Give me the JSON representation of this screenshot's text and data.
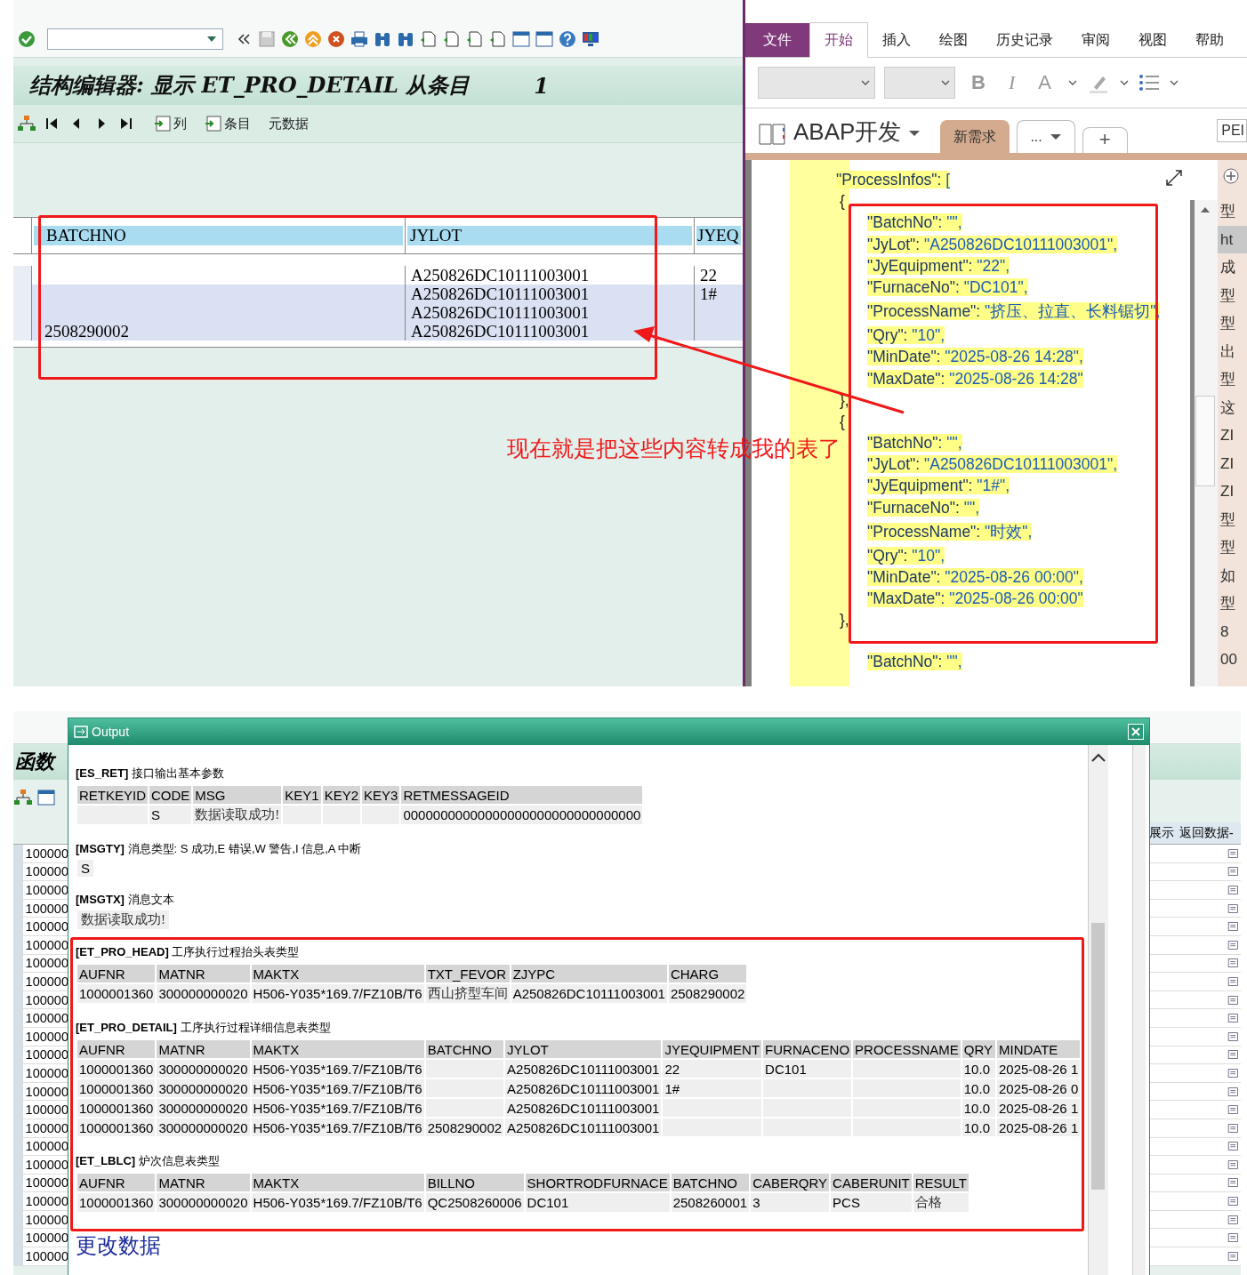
{
  "sap_editor": {
    "title": "结构编辑器: 显示 ET_PRO_DETAIL 从条目",
    "entry_number": "1",
    "toolbar_buttons": [
      {
        "kind": "icon-text",
        "label": "列"
      },
      {
        "kind": "icon-text",
        "label": "条目"
      },
      {
        "kind": "text",
        "label": "元数据"
      }
    ],
    "columns": [
      "BATCHNO",
      "JYLOT",
      "JYEQ"
    ],
    "rows": [
      {
        "cells": [
          "",
          "A250826DC10111003001",
          "22"
        ],
        "highlighted": false
      },
      {
        "cells": [
          "",
          "A250826DC10111003001",
          "1#"
        ],
        "highlighted": true
      },
      {
        "cells": [
          "",
          "A250826DC10111003001",
          ""
        ],
        "highlighted": true
      },
      {
        "cells": [
          "2508290002",
          "A250826DC10111003001",
          ""
        ],
        "highlighted": true
      }
    ]
  },
  "annotation": {
    "text": "现在就是把这些内容转成我的表了"
  },
  "onenote": {
    "ribbon_tabs": [
      {
        "label": "文件",
        "kind": "file",
        "selected": false
      },
      {
        "label": "开始",
        "kind": "tab",
        "selected": true
      },
      {
        "label": "插入",
        "kind": "tab",
        "selected": false
      },
      {
        "label": "绘图",
        "kind": "tab",
        "selected": false
      },
      {
        "label": "历史记录",
        "kind": "tab",
        "selected": false
      },
      {
        "label": "审阅",
        "kind": "tab",
        "selected": false
      },
      {
        "label": "视图",
        "kind": "tab",
        "selected": false
      },
      {
        "label": "帮助",
        "kind": "tab",
        "selected": false
      }
    ],
    "format_buttons": [
      "B",
      "I",
      "A"
    ],
    "notebook": "ABAP开发",
    "section_tabs": [
      {
        "label": "新需求",
        "selected": true
      },
      {
        "label": "...",
        "selected": false
      }
    ],
    "add_section": "+",
    "search_text": "PEI",
    "lines": [
      {
        "kind": "head",
        "key": "\"ProcessInfos\":",
        "value": "["
      },
      {
        "kind": "brace",
        "key": "{"
      },
      {
        "kind": "pair",
        "key": "\"BatchNo\":",
        "value": "\"\","
      },
      {
        "kind": "pair",
        "key": "\"JyLot\":",
        "value": "\"A250826DC10111003001\","
      },
      {
        "kind": "pair",
        "key": "\"JyEquipment\":",
        "value": "\"22\","
      },
      {
        "kind": "pair",
        "key": "\"FurnaceNo\":",
        "value": "\"DC101\","
      },
      {
        "kind": "pair",
        "key": "\"ProcessName\":",
        "value": "\"挤压、拉直、长料锯切\","
      },
      {
        "kind": "pair",
        "key": "\"Qry\":",
        "value": "\"10\","
      },
      {
        "kind": "pair",
        "key": "\"MinDate\":",
        "value": "\"2025-08-26 14:28\","
      },
      {
        "kind": "pair",
        "key": "\"MaxDate\":",
        "value": "\"2025-08-26 14:28\""
      },
      {
        "kind": "brace",
        "key": "},"
      },
      {
        "kind": "brace",
        "key": "{"
      },
      {
        "kind": "pair",
        "key": "\"BatchNo\":",
        "value": "\"\","
      },
      {
        "kind": "pair",
        "key": "\"JyLot\":",
        "value": "\"A250826DC10111003001\","
      },
      {
        "kind": "pair",
        "key": "\"JyEquipment\":",
        "value": "\"1#\","
      },
      {
        "kind": "pair",
        "key": "\"FurnaceNo\":",
        "value": "\"\","
      },
      {
        "kind": "pair",
        "key": "\"ProcessName\":",
        "value": "\"时效\","
      },
      {
        "kind": "pair",
        "key": "\"Qry\":",
        "value": "\"10\","
      },
      {
        "kind": "pair",
        "key": "\"MinDate\":",
        "value": "\"2025-08-26 00:00\","
      },
      {
        "kind": "pair",
        "key": "\"MaxDate\":",
        "value": "\"2025-08-26 00:00\""
      },
      {
        "kind": "brace",
        "key": "},"
      },
      {
        "kind": "pair",
        "key": "\"BatchNo\":",
        "value": "\"\","
      }
    ],
    "pages": [
      {
        "label": "型",
        "selected": false
      },
      {
        "label": "ht",
        "selected": true
      },
      {
        "label": "成",
        "selected": false
      },
      {
        "label": "型",
        "selected": false
      },
      {
        "label": "型",
        "selected": false
      },
      {
        "label": "出",
        "selected": false
      },
      {
        "label": "型",
        "selected": false
      },
      {
        "label": "这",
        "selected": false
      },
      {
        "label": "ZI",
        "selected": false
      },
      {
        "label": "ZI",
        "selected": false
      },
      {
        "label": "ZI",
        "selected": false
      },
      {
        "label": "型",
        "selected": false
      },
      {
        "label": "型",
        "selected": false
      },
      {
        "label": "如",
        "selected": false
      },
      {
        "label": "型",
        "selected": false
      },
      {
        "label": "8",
        "selected": false
      },
      {
        "label": "00",
        "selected": false
      }
    ]
  },
  "function_screen": {
    "title": "函数",
    "right_headers": [
      "展示",
      "返回数据-"
    ],
    "row_keys": [
      "100000",
      "100000",
      "100000",
      "100000",
      "100000",
      "100000",
      "100000",
      "100000",
      "100000",
      "100000",
      "100000",
      "100000",
      "100000",
      "100000",
      "100000",
      "100000",
      "100000",
      "100000",
      "100000",
      "100000",
      "100000",
      "100000",
      "100000"
    ]
  },
  "output": {
    "title": "Output",
    "sections": [
      {
        "kind": "table",
        "tag": "[ES_RET]",
        "description": "接口输出基本参数",
        "columns": [
          "RETKEYID",
          "CODE",
          "MSG",
          "KEY1",
          "KEY2",
          "KEY3",
          "RETMESSAGEID"
        ],
        "rows": [
          [
            "",
            "S",
            "数据读取成功!",
            "",
            "",
            "",
            "00000000000000000000000000000000"
          ]
        ]
      },
      {
        "kind": "value",
        "tag": "[MSGTY]",
        "description": "消息类型: S 成功,E 错误,W 警告,I 信息,A 中断",
        "value": "S"
      },
      {
        "kind": "value",
        "tag": "[MSGTX]",
        "description": "消息文本",
        "value": "数据读取成功!"
      },
      {
        "kind": "table",
        "tag": "[ET_PRO_HEAD]",
        "description": "工序执行过程抬头表类型",
        "columns": [
          "AUFNR",
          "MATNR",
          "MAKTX",
          "TXT_FEVOR",
          "ZJYPC",
          "CHARG"
        ],
        "rows": [
          [
            "1000001360",
            "300000000020",
            "H506-Y035*169.7/FZ10B/T6",
            "西山挤型车间",
            "A250826DC10111003001",
            "2508290002"
          ]
        ]
      },
      {
        "kind": "table",
        "tag": "[ET_PRO_DETAIL]",
        "description": "工序执行过程详细信息表类型",
        "columns": [
          "AUFNR",
          "MATNR",
          "MAKTX",
          "BATCHNO",
          "JYLOT",
          "JYEQUIPMENT",
          "FURNACENO",
          "PROCESSNAME",
          "QRY",
          "MINDATE"
        ],
        "rows": [
          [
            "1000001360",
            "300000000020",
            "H506-Y035*169.7/FZ10B/T6",
            "",
            "A250826DC10111003001",
            "22",
            "DC101",
            "",
            "10.0",
            "2025-08-26 1"
          ],
          [
            "1000001360",
            "300000000020",
            "H506-Y035*169.7/FZ10B/T6",
            "",
            "A250826DC10111003001",
            "1#",
            "",
            "",
            "10.0",
            "2025-08-26 0"
          ],
          [
            "1000001360",
            "300000000020",
            "H506-Y035*169.7/FZ10B/T6",
            "",
            "A250826DC10111003001",
            "",
            "",
            "",
            "10.0",
            "2025-08-26 1"
          ],
          [
            "1000001360",
            "300000000020",
            "H506-Y035*169.7/FZ10B/T6",
            "2508290002",
            "A250826DC10111003001",
            "",
            "",
            "",
            "10.0",
            "2025-08-26 1"
          ]
        ]
      },
      {
        "kind": "table",
        "tag": "[ET_LBLC]",
        "description": "炉次信息表类型",
        "columns": [
          "AUFNR",
          "MATNR",
          "MAKTX",
          "BILLNO",
          "SHORTRODFURNACE",
          "BATCHNO",
          "CABERQRY",
          "CABERUNIT",
          "RESULT"
        ],
        "rows": [
          [
            "1000001360",
            "300000000020",
            "H506-Y035*169.7/FZ10B/T6",
            "QC2508260006",
            "DC101",
            "2508260001",
            "3",
            "PCS",
            "合格"
          ]
        ]
      }
    ],
    "footer_heading": "更改数据"
  }
}
